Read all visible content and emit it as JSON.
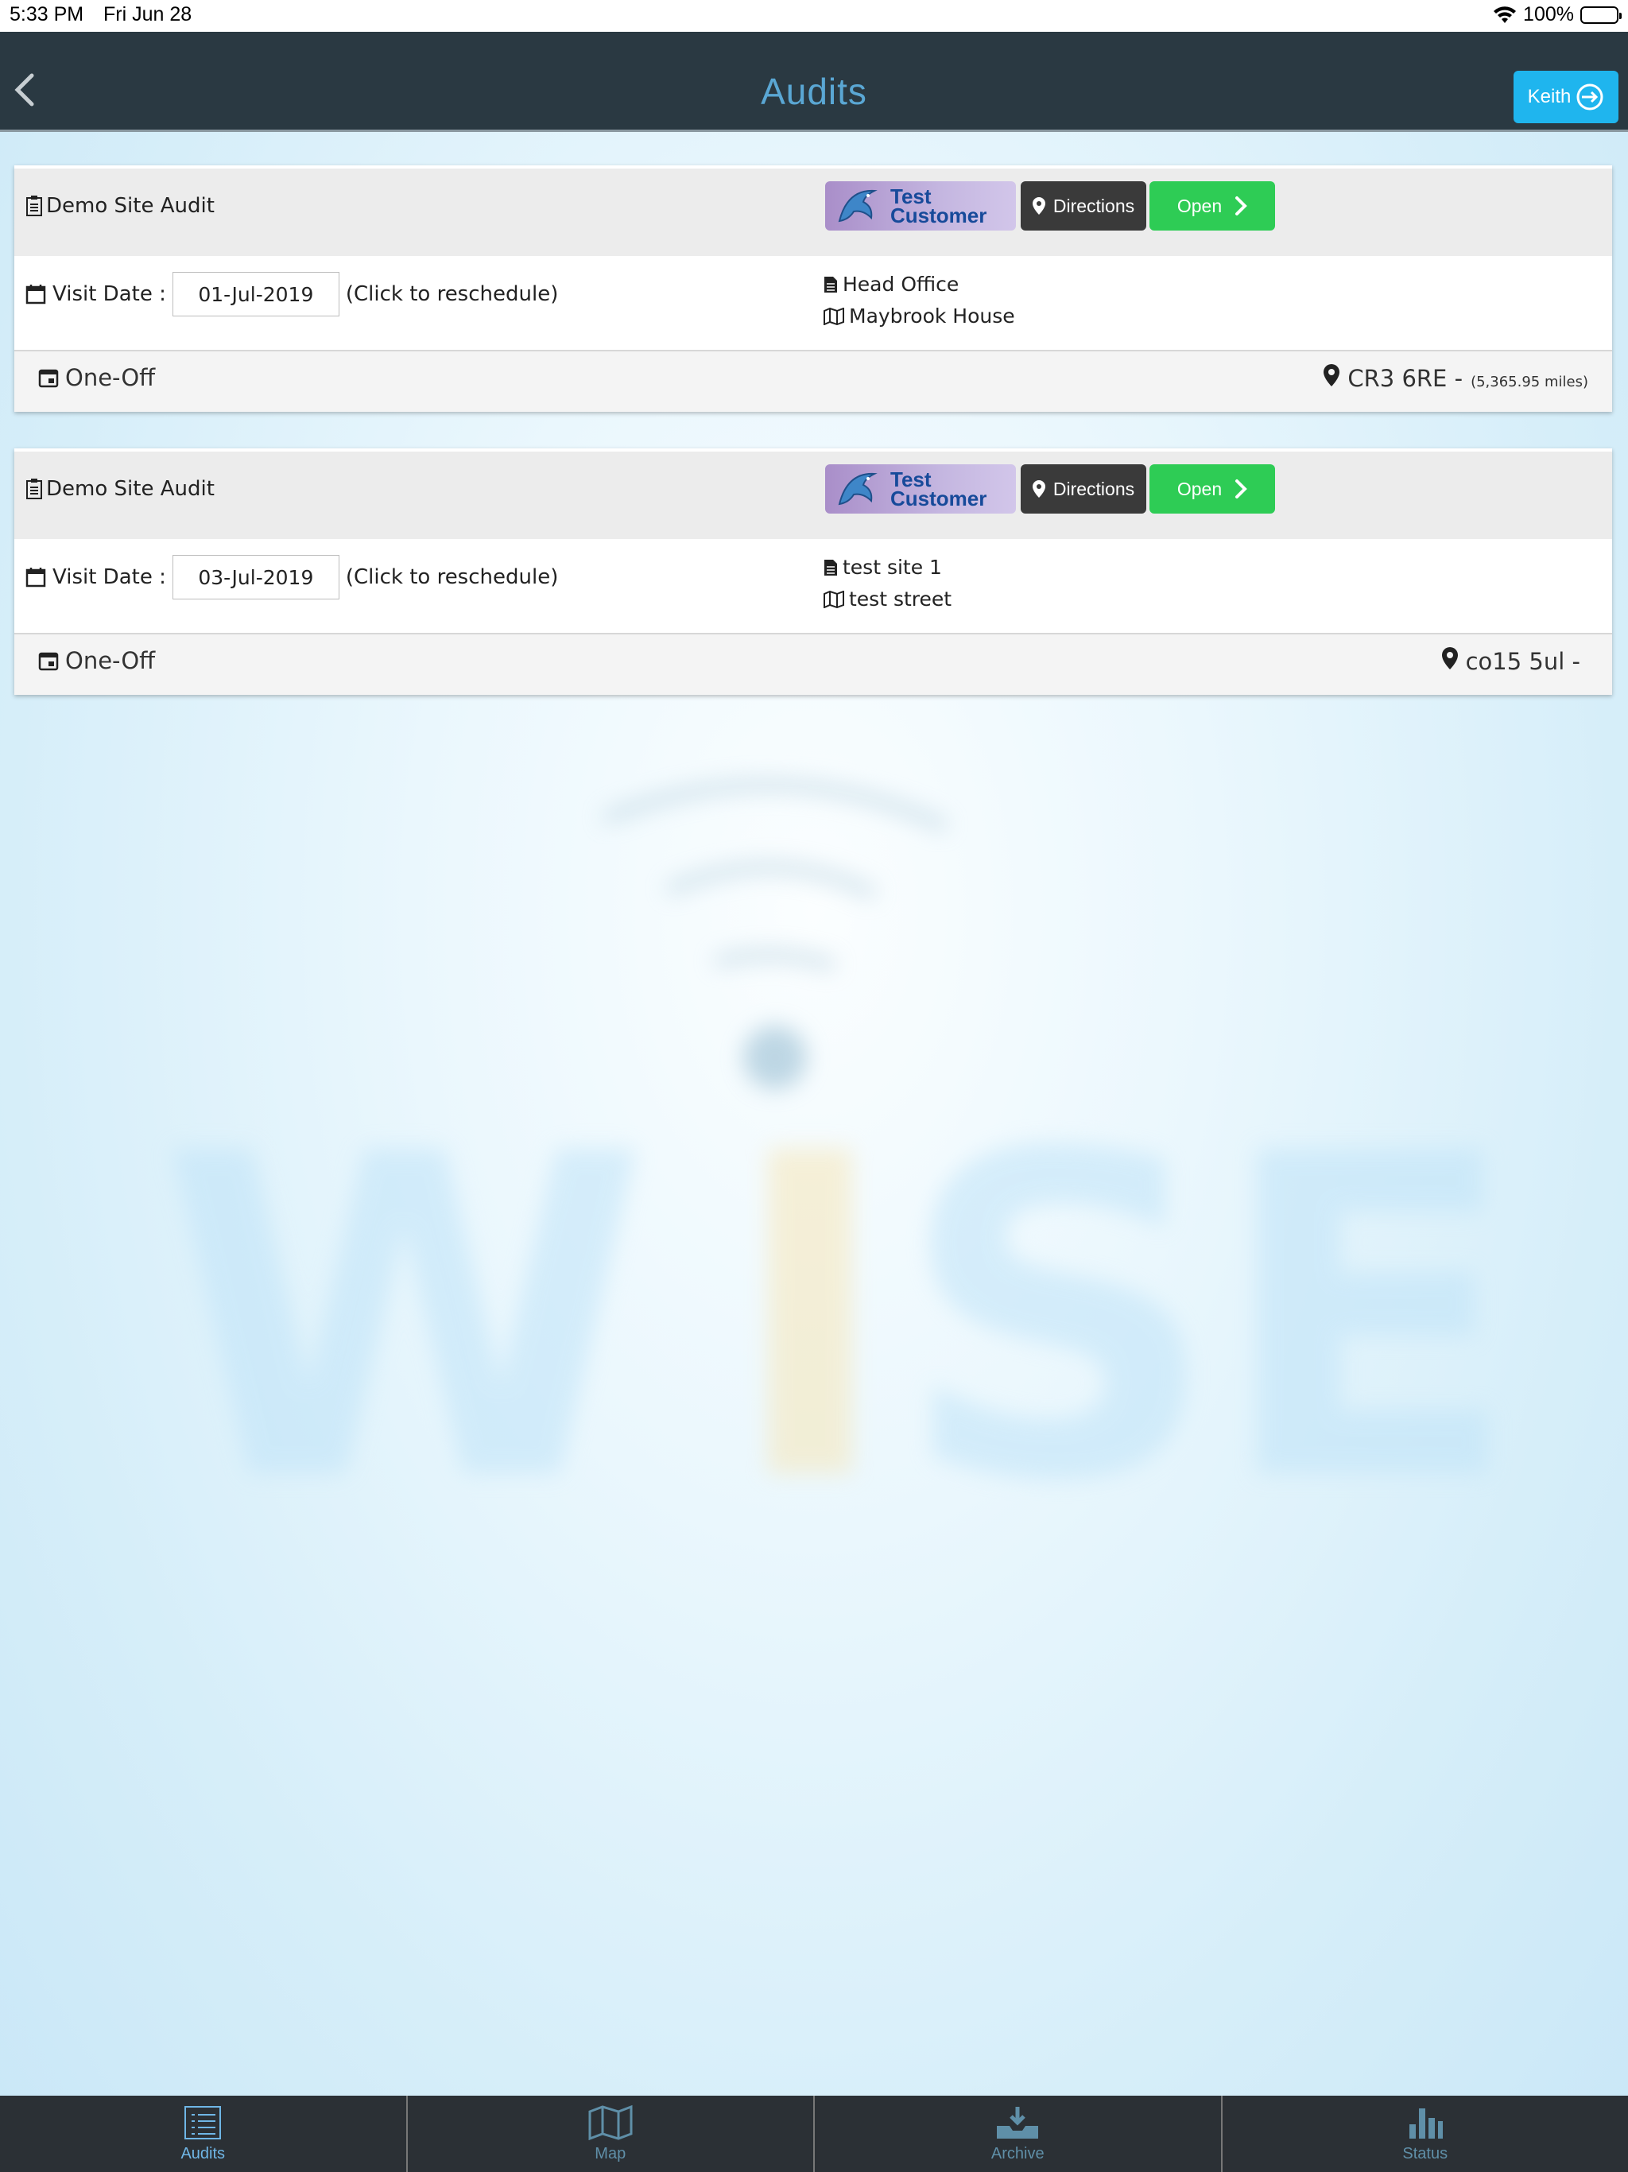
{
  "status_bar": {
    "time": "5:33 PM",
    "date": "Fri Jun 28",
    "battery": "100%"
  },
  "header": {
    "title": "Audits",
    "user": "Keith"
  },
  "audits": [
    {
      "title": "Demo Site Audit",
      "customer": {
        "line1": "Test",
        "line2": "Customer"
      },
      "directions_label": "Directions",
      "open_label": "Open",
      "visit_label": "Visit Date :",
      "visit_date": "01-Jul-2019",
      "reschedule_hint": "(Click to reschedule)",
      "site_name": "Head Office",
      "site_address": "Maybrook House",
      "frequency": "One-Off",
      "postcode": "CR3 6RE -",
      "distance": "(5,365.95 miles)"
    },
    {
      "title": "Demo Site Audit",
      "customer": {
        "line1": "Test",
        "line2": "Customer"
      },
      "directions_label": "Directions",
      "open_label": "Open",
      "visit_label": "Visit Date :",
      "visit_date": "03-Jul-2019",
      "reschedule_hint": "(Click to reschedule)",
      "site_name": "test site 1",
      "site_address": "test street",
      "frequency": "One-Off",
      "postcode": "co15 5ul -",
      "distance": ""
    }
  ],
  "watermark": {
    "text": "WISE"
  },
  "tabs": [
    {
      "label": "Audits",
      "icon": "list-icon",
      "active": true
    },
    {
      "label": "Map",
      "icon": "map-icon",
      "active": false
    },
    {
      "label": "Archive",
      "icon": "archive-icon",
      "active": false
    },
    {
      "label": "Status",
      "icon": "bar-chart-icon",
      "active": false
    }
  ],
  "colors": {
    "nav_bg": "#2a3942",
    "title": "#5aa7d4",
    "user_btn": "#1fb5ee",
    "open_btn": "#2ecc55",
    "directions_btn": "#3a3a3a"
  }
}
